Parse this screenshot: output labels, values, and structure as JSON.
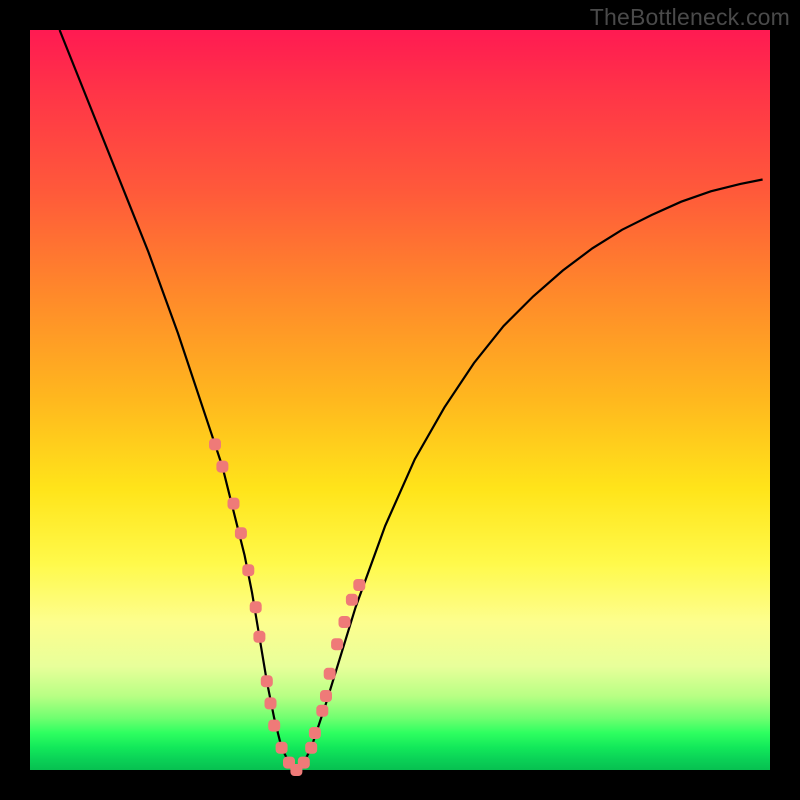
{
  "watermark": "TheBottleneck.com",
  "colors": {
    "frame": "#000000",
    "curve": "#000000",
    "marker": "#ef7a78",
    "grad_top": "#ff1a52",
    "grad_mid": "#ffe41a",
    "grad_bottom": "#07c050"
  },
  "chart_data": {
    "type": "line",
    "title": "",
    "xlabel": "",
    "ylabel": "",
    "xlim": [
      0,
      100
    ],
    "ylim": [
      0,
      100
    ],
    "series": [
      {
        "name": "bottleneck-curve",
        "x": [
          4,
          8,
          12,
          16,
          20,
          24,
          26,
          28,
          29,
          30,
          31,
          32,
          33,
          34,
          35,
          36,
          37,
          38,
          40,
          44,
          48,
          52,
          56,
          60,
          64,
          68,
          72,
          76,
          80,
          84,
          88,
          92,
          96,
          99
        ],
        "values": [
          100,
          90,
          80,
          70,
          59,
          47,
          41,
          33,
          29,
          24,
          18,
          12,
          7,
          3,
          1,
          0,
          1,
          3,
          9,
          22,
          33,
          42,
          49,
          55,
          60,
          64,
          67.5,
          70.5,
          73,
          75,
          76.8,
          78.2,
          79.2,
          79.8
        ]
      }
    ],
    "markers": {
      "name": "highlighted-points",
      "x": [
        25,
        26,
        27.5,
        28.5,
        29.5,
        30.5,
        31,
        32,
        32.5,
        33,
        34,
        35,
        36,
        37,
        38,
        38.5,
        39.5,
        40,
        40.5,
        41.5,
        42.5,
        43.5,
        44.5
      ],
      "values": [
        44,
        41,
        36,
        32,
        27,
        22,
        18,
        12,
        9,
        6,
        3,
        1,
        0,
        1,
        3,
        5,
        8,
        10,
        13,
        17,
        20,
        23,
        25
      ]
    }
  }
}
